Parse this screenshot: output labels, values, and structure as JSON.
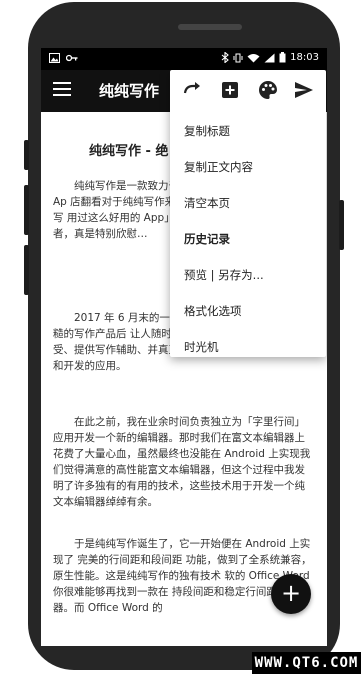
{
  "status_bar": {
    "time": "18:03"
  },
  "app_bar": {
    "title": "纯纯写作"
  },
  "document": {
    "title": "纯纯写作 - 绝",
    "paragraphs": [
      "纯纯写作是一款致力于提供快速、优秀写作体验的 Ap 店翻看对于纯纯写作来说 能够找到大量用户对纯纯写 用过这么好用的 App」、「 这个 App」、「一见倾心 发者，真是特别欣慰…",
      "2017 年 6 月末的一 用导致的各种文本丢失 意、粗糙的写作产品后 让人随时随地能够获得安心的写作感受、提供写作辅助、并真正从写作者角度出发进行设计和开发的应用。",
      "在此之前，我在业余时间负责独立为「字里行间」应用开发一个新的编辑器。那时我们在富文本编辑器上花费了大量心血，虽然最终也没能在 Android 上实现我们觉得满意的高性能富文本编辑器，但这个过程中我发明了许多独有的有用的技术，这些技术用于开发一个纯文本编辑器绰绰有余。",
      "于是纯纯写作诞生了，它一开始便在 Android 上实现了 完美的行间距和段间距 功能，做到了全系统兼容，原生性能。这是纯纯写作的独有技术 软的 Office Word 你很难能够再找到一款在 持段间距和稳定行间距的编辑器。而 Office Word 的"
    ]
  },
  "popup_menu": {
    "toolbar_icons": [
      "redo-icon",
      "add-box-icon",
      "palette-icon",
      "send-icon"
    ],
    "items": [
      {
        "label": "复制标题",
        "bold": false
      },
      {
        "label": "复制正文内容",
        "bold": false
      },
      {
        "label": "清空本页",
        "bold": false
      },
      {
        "label": "历史记录",
        "bold": true
      },
      {
        "label": "预览 | 另存为...",
        "bold": false
      },
      {
        "label": "格式化选项",
        "bold": false
      },
      {
        "label": "时光机",
        "bold": false
      }
    ]
  },
  "fab": {
    "label": "+"
  },
  "watermark": {
    "text": "WWW.QT6.COM"
  }
}
